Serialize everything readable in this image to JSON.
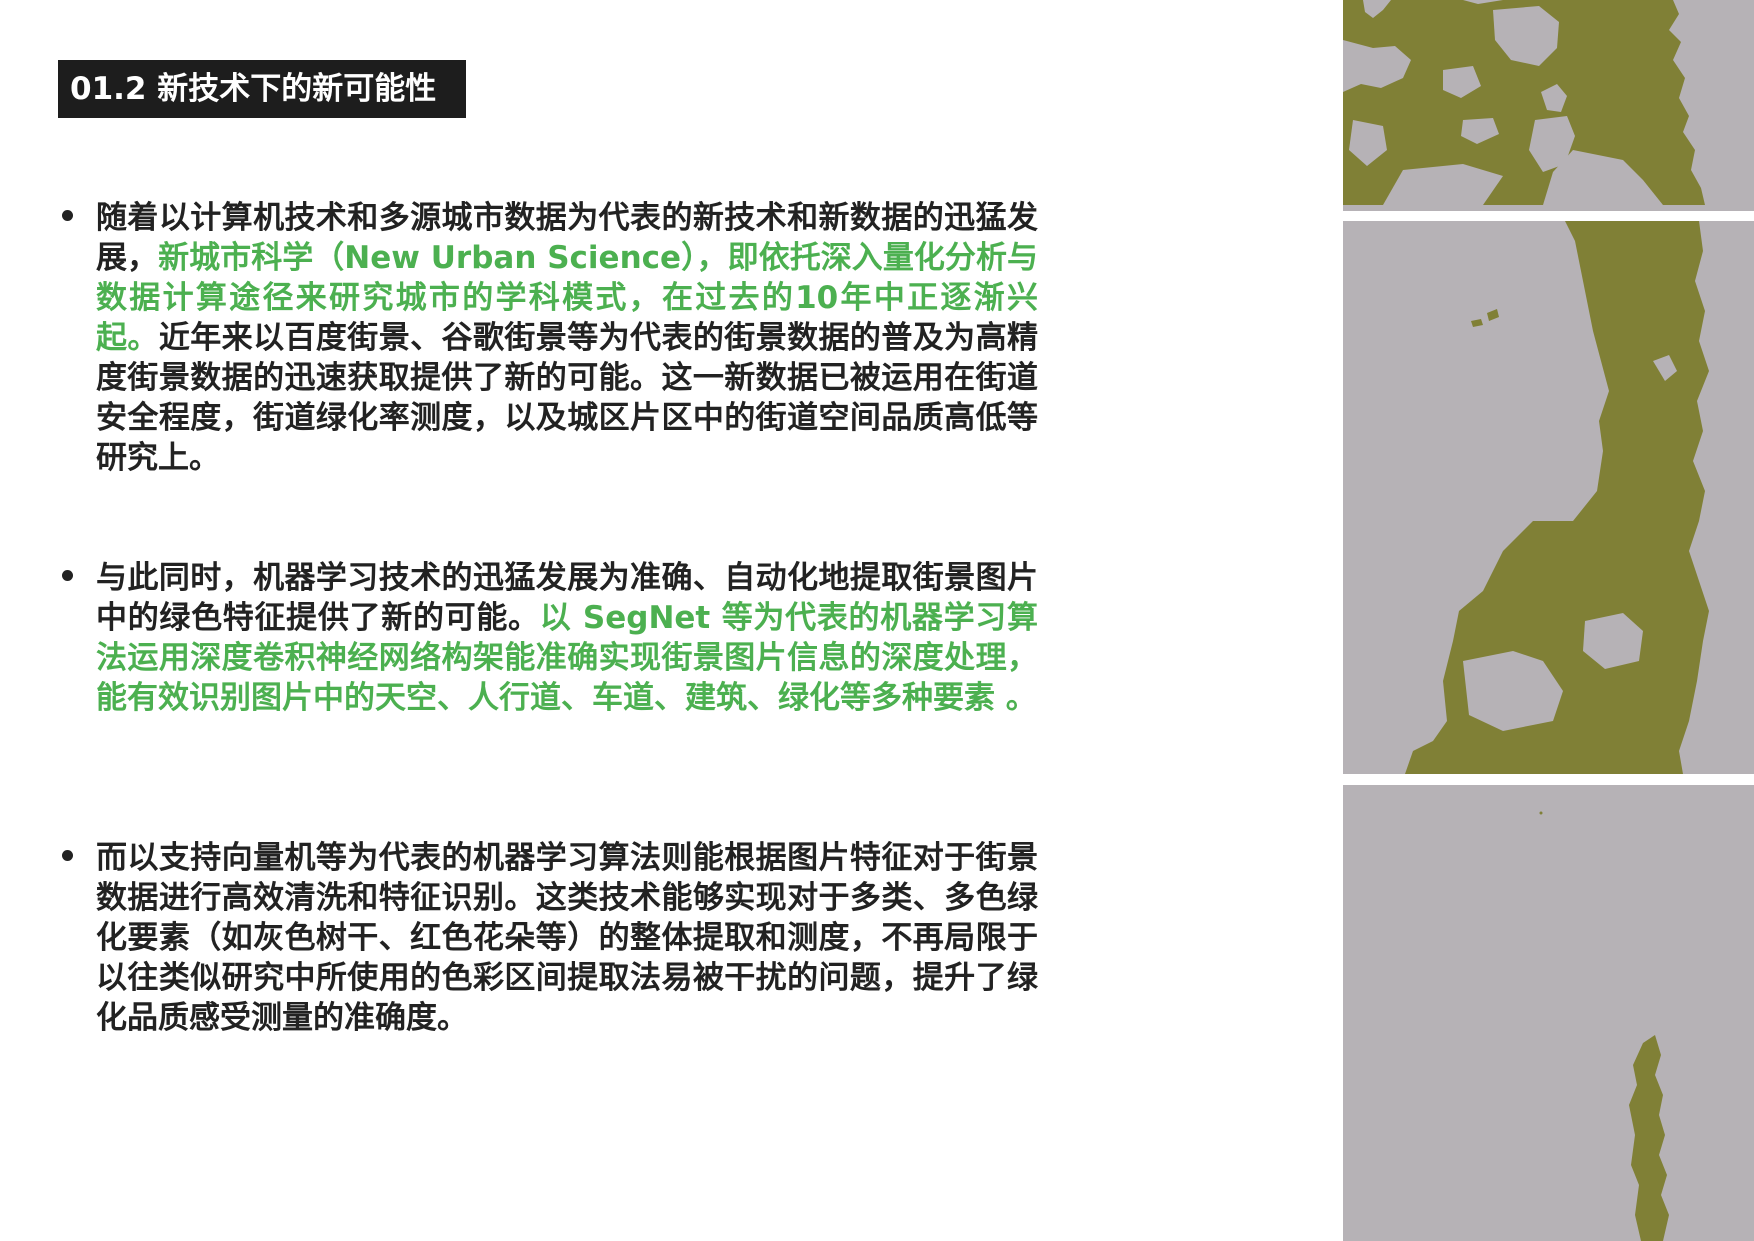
{
  "header": {
    "title": "01.2 新技术下的新可能性"
  },
  "bullets": [
    {
      "seg1": "随着以计算机技术和多源城市数据为代表的新技术和新数据的迅猛发展，",
      "highlight": "新城市科学（New Urban Science），即依托深入量化分析与数据计算途径来研究城市的学科模式，在过去的10年中正逐渐兴起。",
      "seg2": "近年来以百度街景、谷歌街景等为代表的街景数据的普及为高精度街景数据的迅速获取提供了新的可能。这一新数据已被运用在街道安全程度，街道绿化率测度，以及城区片区中的街道空间品质高低等研究上。"
    },
    {
      "seg1": "与此同时，机器学习技术的迅猛发展为准确、自动化地提取街景图片中的绿色特征提供了新的可能。",
      "highlight": "以 SegNet 等为代表的机器学习算法运用深度卷积神经网络构架能准确实现街景图片信息的深度处理，能有效识别图片中的天空、人行道、车道、建筑、绿化等多种要素 。",
      "seg2": ""
    },
    {
      "seg1": "而以支持向量机等为代表的机器学习算法则能根据图片特征对于街景数据进行高效清洗和特征识别。这类技术能够实现对于多类、多色绿化要素（如灰色树干、红色花朵等）的整体提取和测度，不再局限于以往类似研究中所使用的色彩区间提取法易被干扰的问题，提升了绿化品质感受测量的准确度。",
      "highlight": "",
      "seg2": ""
    }
  ],
  "colors": {
    "highlight": "#4cb050",
    "title_bg": "#1d1d1d",
    "panel_bg": "#b6b2b6",
    "vegetation": "#808036"
  }
}
